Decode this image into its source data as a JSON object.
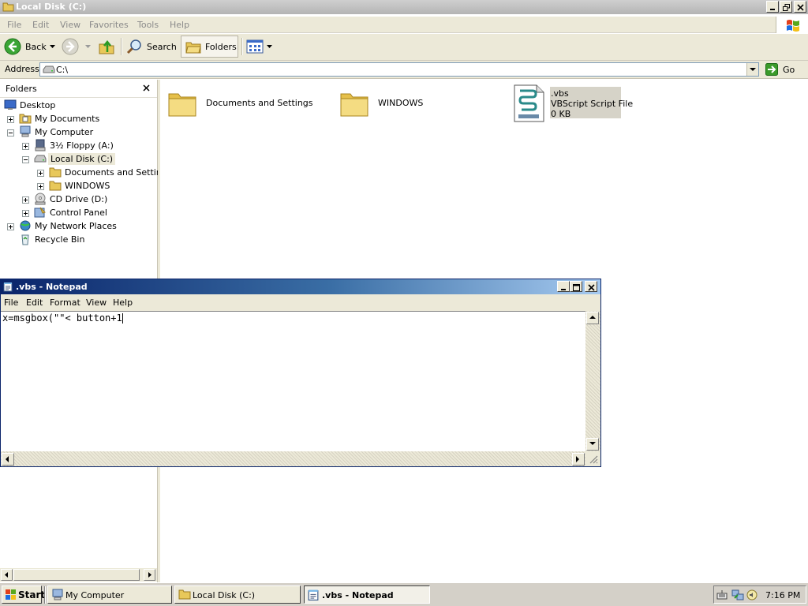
{
  "explorer": {
    "title": "Local Disk (C:)",
    "menu": [
      "File",
      "Edit",
      "View",
      "Favorites",
      "Tools",
      "Help"
    ],
    "toolbar": {
      "back_label": "Back",
      "search_label": "Search",
      "folders_label": "Folders"
    },
    "address": {
      "label": "Address",
      "value": "C:\\",
      "go_label": "Go"
    },
    "folders_pane": {
      "title": "Folders",
      "items": [
        {
          "label": "Desktop"
        },
        {
          "label": "My Documents"
        },
        {
          "label": "My Computer"
        },
        {
          "label": "3½ Floppy (A:)"
        },
        {
          "label": "Local Disk (C:)",
          "selected": true
        },
        {
          "label": "Documents and Settings"
        },
        {
          "label": "WINDOWS"
        },
        {
          "label": "CD Drive (D:)"
        },
        {
          "label": "Control Panel"
        },
        {
          "label": "My Network Places"
        },
        {
          "label": "Recycle Bin"
        }
      ]
    },
    "files": [
      {
        "name": "Documents and Settings",
        "icon": "folder-icon"
      },
      {
        "name": "WINDOWS",
        "icon": "folder-icon"
      },
      {
        "name": ".vbs",
        "type": "VBScript Script File",
        "size": "0 KB",
        "icon": "vbscript-file-icon",
        "selected": true
      }
    ]
  },
  "notepad": {
    "title": ".vbs - Notepad",
    "menu": [
      "File",
      "Edit",
      "Format",
      "View",
      "Help"
    ],
    "text": "x=msgbox(\"\"< button+1"
  },
  "taskbar": {
    "start_label": "Start",
    "tasks": [
      {
        "label": "My Computer",
        "active": false
      },
      {
        "label": "Local Disk (C:)",
        "active": false
      },
      {
        "label": ".vbs - Notepad",
        "active": true
      }
    ],
    "clock": "7:16 PM"
  },
  "colors": {
    "titlebar_active": "#0a246a",
    "titlebar_inactive": "#b4b4b4",
    "window_face": "#ece9d8",
    "go_arrow": "#3a9a2a"
  }
}
